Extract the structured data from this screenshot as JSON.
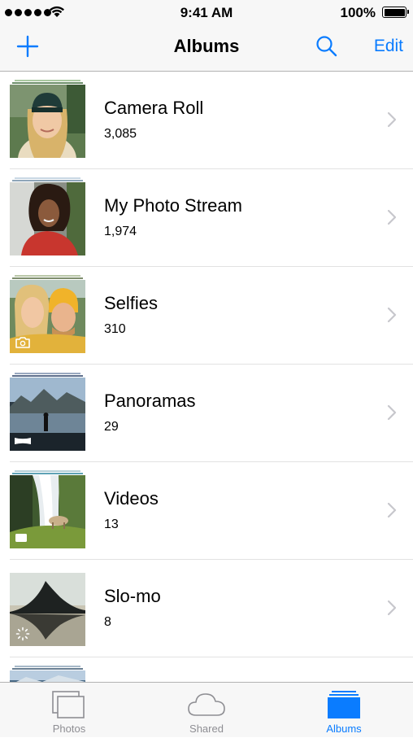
{
  "status_bar": {
    "time": "9:41 AM",
    "battery_percent": "100%",
    "signal_bars": 5,
    "wifi_icon": "wifi-icon",
    "battery_level": 1.0
  },
  "nav": {
    "title": "Albums",
    "add_icon": "plus-icon",
    "search_icon": "search-icon",
    "edit_label": "Edit"
  },
  "colors": {
    "accent": "#0a7cff",
    "inactive_tab": "#8e8e93",
    "chevron": "#c7c7cc"
  },
  "albums": [
    {
      "name": "Camera Roll",
      "count": "3,085",
      "badge": null
    },
    {
      "name": "My Photo Stream",
      "count": "1,974",
      "badge": null
    },
    {
      "name": "Selfies",
      "count": "310",
      "badge": "front-camera-icon"
    },
    {
      "name": "Panoramas",
      "count": "29",
      "badge": "panorama-icon"
    },
    {
      "name": "Videos",
      "count": "13",
      "badge": "video-icon"
    },
    {
      "name": "Slo-mo",
      "count": "8",
      "badge": "slo-mo-icon"
    }
  ],
  "tabs": [
    {
      "label": "Photos",
      "icon": "photos-icon",
      "active": false
    },
    {
      "label": "Shared",
      "icon": "cloud-icon",
      "active": false
    },
    {
      "label": "Albums",
      "icon": "albums-icon",
      "active": true
    }
  ]
}
